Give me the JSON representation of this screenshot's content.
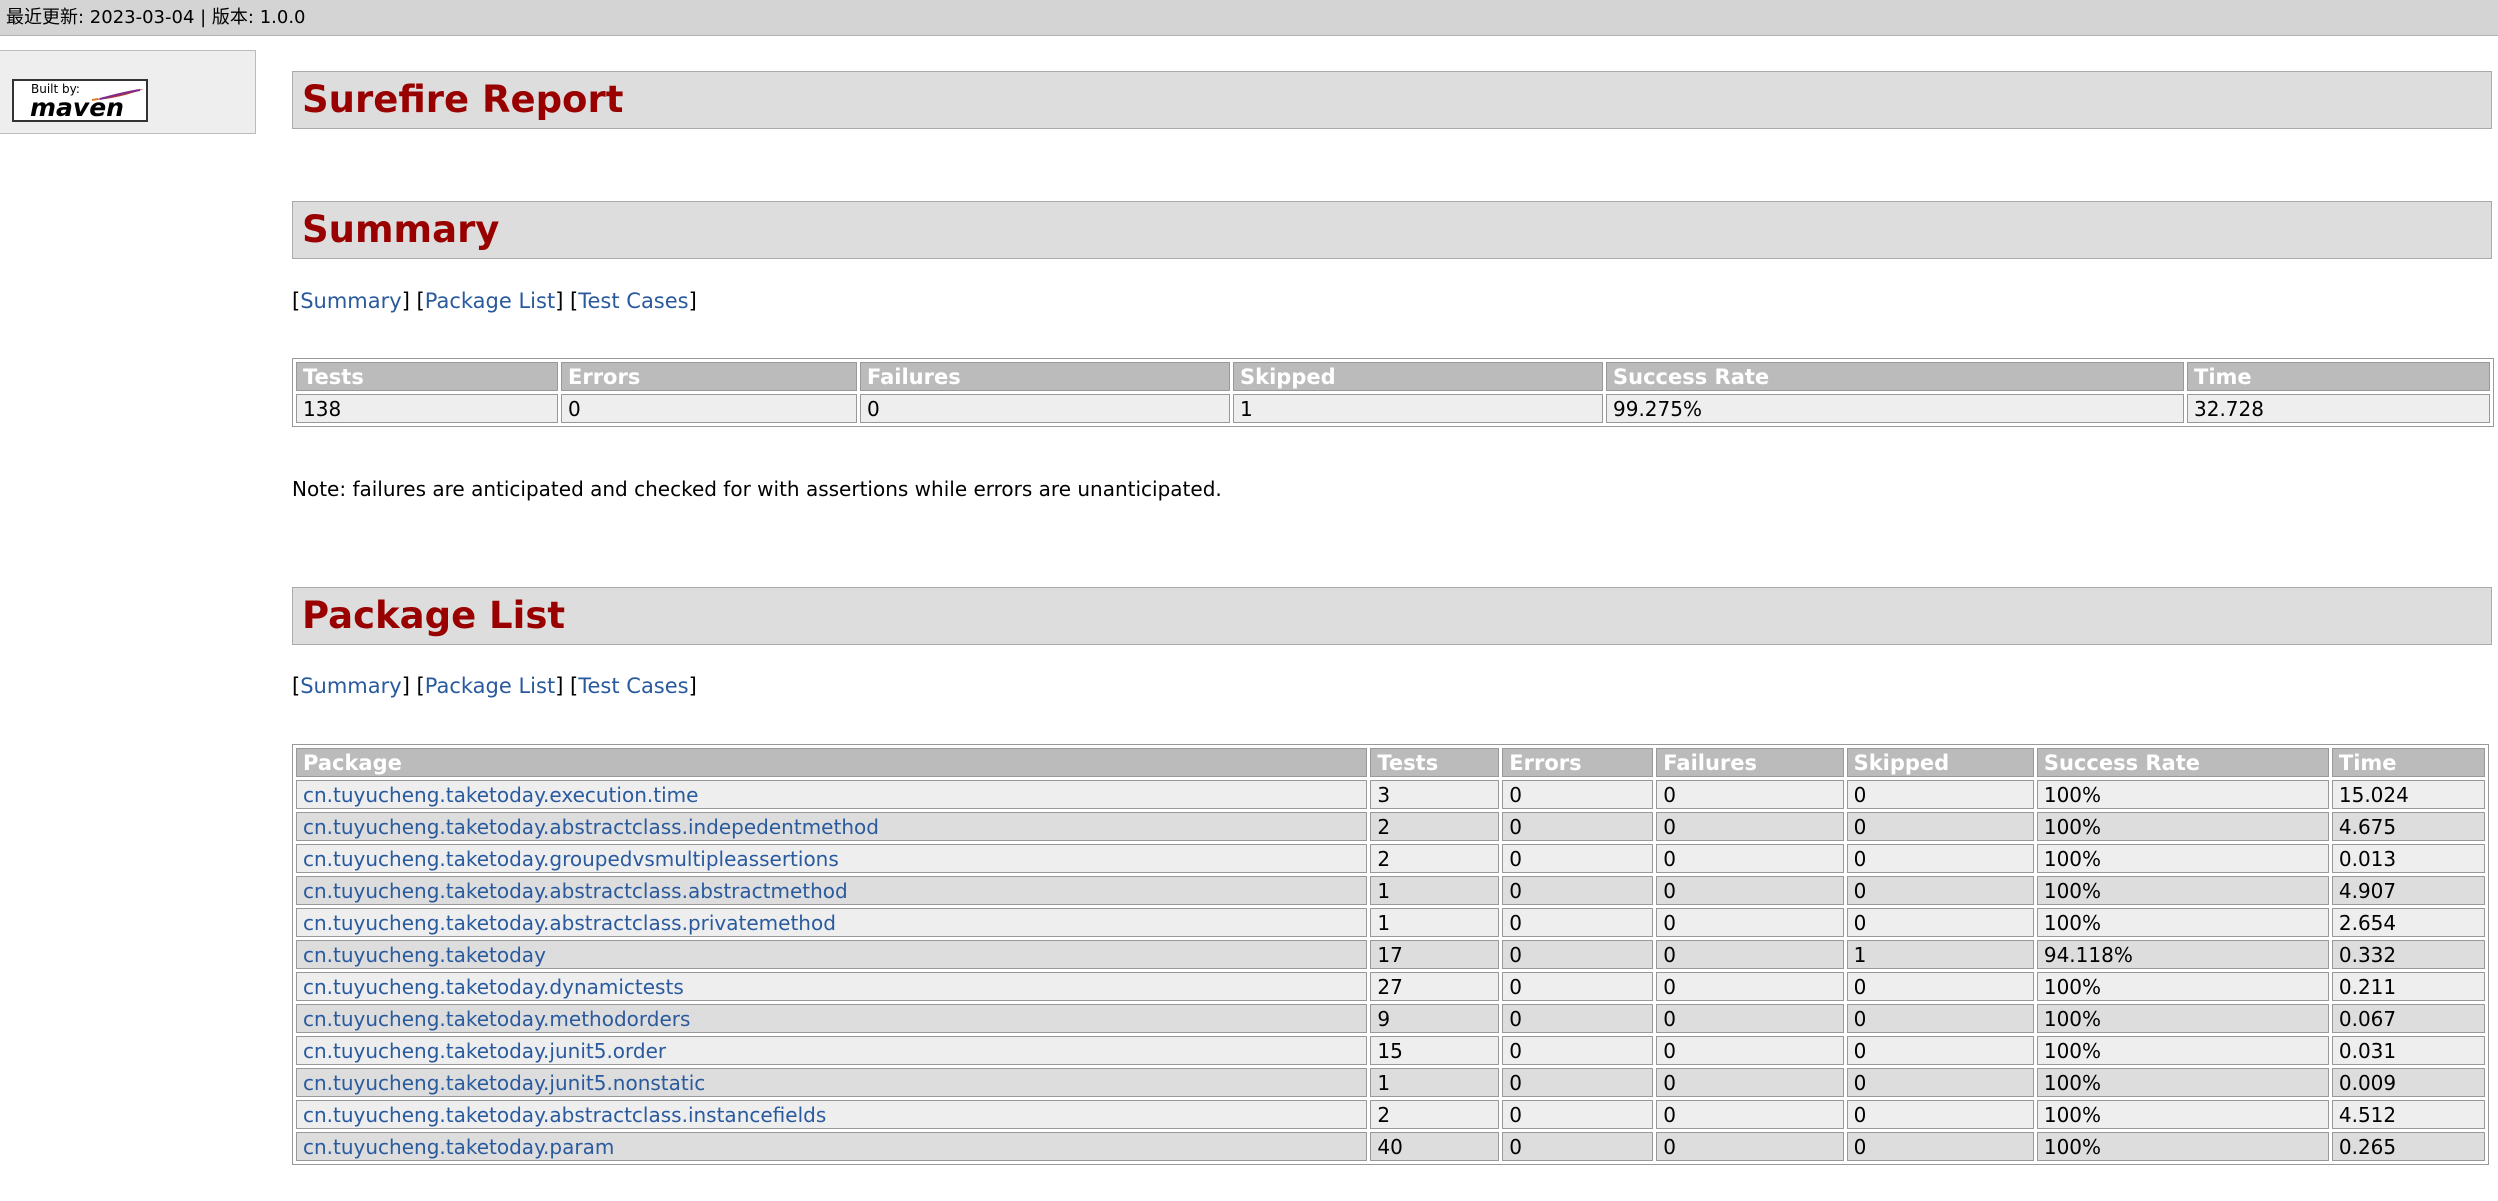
{
  "topbar": {
    "last_updated": "最近更新: 2023-03-04",
    "separator": " | ",
    "version": "版本: 1.0.0"
  },
  "sidebar": {
    "badge_built_by": "Built by:",
    "badge_maven": "maven"
  },
  "page_title": "Surefire Report",
  "summary_section": {
    "title": "Summary",
    "nav": [
      "Summary",
      "Package List",
      "Test Cases"
    ],
    "headers": [
      "Tests",
      "Errors",
      "Failures",
      "Skipped",
      "Success Rate",
      "Time"
    ],
    "row": [
      "138",
      "0",
      "0",
      "1",
      "99.275%",
      "32.728"
    ],
    "note": "Note: failures are anticipated and checked for with assertions while errors are unanticipated."
  },
  "package_section": {
    "title": "Package List",
    "nav": [
      "Summary",
      "Package List",
      "Test Cases"
    ],
    "headers": [
      "Package",
      "Tests",
      "Errors",
      "Failures",
      "Skipped",
      "Success Rate",
      "Time"
    ],
    "rows": [
      [
        "cn.tuyucheng.taketoday.execution.time",
        "3",
        "0",
        "0",
        "0",
        "100%",
        "15.024"
      ],
      [
        "cn.tuyucheng.taketoday.abstractclass.indepedentmethod",
        "2",
        "0",
        "0",
        "0",
        "100%",
        "4.675"
      ],
      [
        "cn.tuyucheng.taketoday.groupedvsmultipleassertions",
        "2",
        "0",
        "0",
        "0",
        "100%",
        "0.013"
      ],
      [
        "cn.tuyucheng.taketoday.abstractclass.abstractmethod",
        "1",
        "0",
        "0",
        "0",
        "100%",
        "4.907"
      ],
      [
        "cn.tuyucheng.taketoday.abstractclass.privatemethod",
        "1",
        "0",
        "0",
        "0",
        "100%",
        "2.654"
      ],
      [
        "cn.tuyucheng.taketoday",
        "17",
        "0",
        "0",
        "1",
        "94.118%",
        "0.332"
      ],
      [
        "cn.tuyucheng.taketoday.dynamictests",
        "27",
        "0",
        "0",
        "0",
        "100%",
        "0.211"
      ],
      [
        "cn.tuyucheng.taketoday.methodorders",
        "9",
        "0",
        "0",
        "0",
        "100%",
        "0.067"
      ],
      [
        "cn.tuyucheng.taketoday.junit5.order",
        "15",
        "0",
        "0",
        "0",
        "100%",
        "0.031"
      ],
      [
        "cn.tuyucheng.taketoday.junit5.nonstatic",
        "1",
        "0",
        "0",
        "0",
        "100%",
        "0.009"
      ],
      [
        "cn.tuyucheng.taketoday.abstractclass.instancefields",
        "2",
        "0",
        "0",
        "0",
        "100%",
        "4.512"
      ],
      [
        "cn.tuyucheng.taketoday.param",
        "40",
        "0",
        "0",
        "0",
        "100%",
        "0.265"
      ]
    ]
  },
  "colors": {
    "heading": "#990000",
    "link": "#2a5a9e",
    "header_cell": "#bbbbbb",
    "row_a": "#eeeeee",
    "row_b": "#dddddd",
    "section_band": "#dddddd"
  }
}
